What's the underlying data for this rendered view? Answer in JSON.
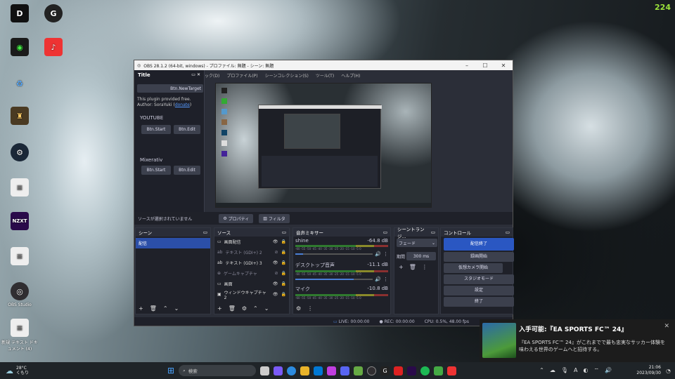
{
  "desktop": {
    "fps": "224",
    "icons": [
      {
        "label": "",
        "icon": "app-icon"
      },
      {
        "label": "",
        "icon": "logitech-icon"
      },
      {
        "label": "",
        "icon": "app-icon"
      },
      {
        "label": "",
        "icon": "app-icon"
      },
      {
        "label": "",
        "icon": "recycle-bin-icon"
      },
      {
        "label": "",
        "icon": "game-icon"
      },
      {
        "label": "",
        "icon": "steam-icon"
      },
      {
        "label": "",
        "icon": "text-document-icon"
      },
      {
        "label": "",
        "icon": "nzxt-icon"
      },
      {
        "label": "",
        "icon": "text-document-icon"
      },
      {
        "label": "OBS Studio",
        "icon": "obs-icon"
      },
      {
        "label": "新規 テキスト ドキュメント (4)",
        "icon": "text-document-icon"
      }
    ]
  },
  "obs": {
    "title": "OBS 28.1.2 (64-bit, windows) - プロファイル: 無題 - シーン: 無題",
    "menu": [
      "ック(D)",
      "プロファイル(P)",
      "シーンコレクション(S)",
      "ツール(T)",
      "ヘルプ(H)"
    ],
    "dock": {
      "title": "Title",
      "new_target": "Btn.NewTarget",
      "info_line1": "This plugin provided free.",
      "info_line2": "Author: SoraYuki (",
      "info_donate": "donate",
      "info_close": ")",
      "section1": "YOUTUBE",
      "section2": "Mixerativ",
      "start": "Btn.Start",
      "edit": "Btn.Edit"
    },
    "propbar": {
      "status": "ソースが選択されていません",
      "properties": "プロパティ",
      "filters": "フィルタ"
    },
    "scenes": {
      "title": "シーン",
      "items": [
        "配信"
      ]
    },
    "sources": {
      "title": "ソース",
      "items": [
        "画面配信",
        "テキスト (GDI+) 2",
        "テキスト (GDI+) 3",
        "ゲームキャプチャ",
        "画面",
        "ウィンドウキャプチャ 2"
      ]
    },
    "mixer": {
      "title": "音声ミキサー",
      "scale": "-60 -55 -50 -45 -40 -35 -30 -25 -20 -15 -10 -5 0",
      "channels": [
        {
          "name": "shine",
          "db": "-64.8 dB",
          "fader": 0.1
        },
        {
          "name": "デスクトップ音声",
          "db": "-11.1 dB",
          "fader": 0.75
        },
        {
          "name": "マイク",
          "db": "-10.8 dB",
          "fader": 0.75
        }
      ]
    },
    "transitions": {
      "title": "シーントランジ...",
      "type": "フェード",
      "duration_label": "期間",
      "duration": "300 ms"
    },
    "controls": {
      "title": "コントロール",
      "buttons": [
        "配信終了",
        "録画開始",
        "仮想カメラ開始",
        "スタジオモード",
        "設定",
        "終了"
      ]
    },
    "status": {
      "live": "LIVE: 00:00:00",
      "rec": "REC: 00:00:00",
      "cpu": "CPU: 0.5%, 48.00 fps"
    }
  },
  "notification": {
    "title": "入手可能:『EA SPORTS FC™ 24』",
    "body": "『EA SPORTS FC™ 24』がこれまでで最も忠実なサッカー体験を味わえる世界のゲームへと招待する。"
  },
  "taskbar": {
    "weather_temp": "28°C",
    "weather_text": "くもり",
    "search": "検索",
    "time": "21:06",
    "date": "2023/09/30"
  }
}
